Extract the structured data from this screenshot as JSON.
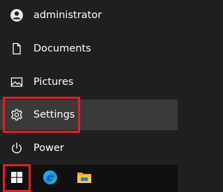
{
  "start_menu": {
    "items": [
      {
        "label": "administrator",
        "icon": "user-avatar-icon"
      },
      {
        "label": "Documents",
        "icon": "document-icon"
      },
      {
        "label": "Pictures",
        "icon": "picture-icon"
      },
      {
        "label": "Settings",
        "icon": "gear-icon"
      },
      {
        "label": "Power",
        "icon": "power-icon"
      }
    ]
  },
  "taskbar": {
    "buttons": [
      {
        "icon": "windows-logo-icon"
      },
      {
        "icon": "edge-browser-icon"
      },
      {
        "icon": "file-explorer-icon"
      }
    ]
  },
  "colors": {
    "menu_background": "#1f1f1f",
    "hover_background": "#3a3a3a",
    "highlight_border": "#e0202a",
    "taskbar_background": "#101010",
    "text": "#ffffff"
  }
}
